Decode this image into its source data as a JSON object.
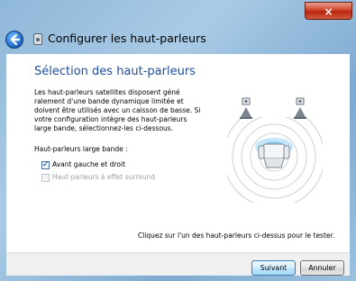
{
  "window": {
    "close_glyph": "×",
    "title": "Configurer les haut-parleurs",
    "back_icon": "back-arrow-icon",
    "title_icon": "speaker-icon"
  },
  "page": {
    "heading": "Sélection des haut-parleurs",
    "description": "Les haut-parleurs satellites disposent géné\nralement d'une bande dynamique limitée et\ndoivent être utilisés avec un caisson de basse. Si\nvotre configuration intègre des haut-parleurs\nlarge bande, sélectionnez-les ci-dessous.",
    "group_label": "Haut-parleurs large bande :",
    "options": [
      {
        "label": "Avant gauche et droit",
        "checked": true,
        "enabled": true
      },
      {
        "label": "Haut-parleurs à effet surround",
        "checked": false,
        "enabled": false
      }
    ],
    "hint": "Cliquez sur l'un des haut-parleurs ci-dessus pour le tester."
  },
  "buttons": {
    "next": "Suivant",
    "cancel": "Annuler"
  },
  "colors": {
    "heading": "#1e4ea0",
    "close": "#c8391f",
    "diagram_accent": "#7fc6ef"
  }
}
